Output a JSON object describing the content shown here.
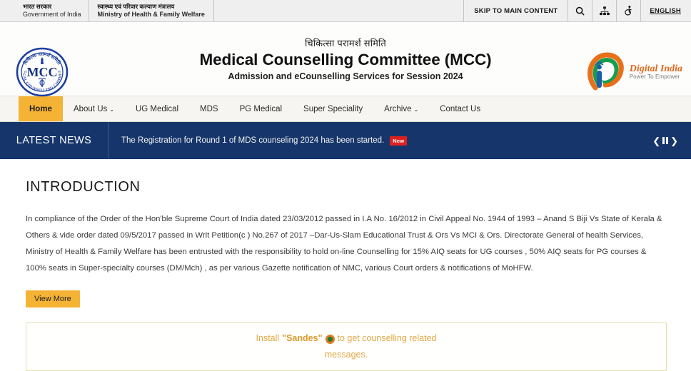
{
  "topbar": {
    "gov_hindi": "भारत सरकार",
    "gov_english": "Government of India",
    "ministry_hindi": "स्वास्थ्य एवं परिवार कल्याण मंत्रालय",
    "ministry_english": "Ministry of Health & Family Welfare",
    "skip_label": "SKIP TO MAIN CONTENT",
    "search_icon": "search-icon",
    "sitemap_icon": "sitemap-icon",
    "accessibility_icon": "accessibility-icon",
    "language_label": "ENGLISH"
  },
  "masthead": {
    "logo_text": "MCC",
    "logo_alt": "mcc-emblem",
    "title_hindi": "चिकित्सा परामर्श समिति",
    "title_main": "Medical Counselling Committee (MCC)",
    "title_sub": "Admission and eCounselling Services for Session 2024",
    "digital_india_name": "Digital India",
    "digital_india_tagline": "Power To Empower"
  },
  "nav": {
    "items": [
      {
        "label": "Home",
        "active": true,
        "caret": ""
      },
      {
        "label": "About Us",
        "active": false,
        "caret": "⌄"
      },
      {
        "label": "UG Medical",
        "active": false,
        "caret": ""
      },
      {
        "label": "MDS",
        "active": false,
        "caret": ""
      },
      {
        "label": "PG Medical",
        "active": false,
        "caret": ""
      },
      {
        "label": "Super Speciality",
        "active": false,
        "caret": ""
      },
      {
        "label": "Archive",
        "active": false,
        "caret": "⌄"
      },
      {
        "label": "Contact Us",
        "active": false,
        "caret": ""
      }
    ]
  },
  "news": {
    "label": "LATEST NEWS",
    "headline": "The Registration for Round 1 of MDS counseling 2024 has been started.",
    "badge": "New",
    "prev_icon": "chevron-left-icon",
    "pause_icon": "pause-icon",
    "next_icon": "chevron-right-icon"
  },
  "intro": {
    "heading": "INTRODUCTION",
    "paragraph": "In compliance of the Order of the Hon'ble Supreme Court of India dated 23/03/2012 passed in I.A No. 16/2012 in Civil Appeal No. 1944 of 1993 – Anand S Biji Vs State of Kerala & Others & vide order dated 09/5/2017 passed in Writ Petition(c ) No.267 of 2017 –Dar-Us-Slam Educational Trust & Ors Vs MCI & Ors. Directorate General of health Services, Ministry of Health & Family Welfare has been entrusted with the responsibility to hold on-line Counselling for 15% AIQ seats for UG courses , 50% AIQ seats for PG courses & 100% seats in Super-specialty courses (DM/Mch) , as per various Gazette notification of NMC, various Court orders & notifications of MoHFW.",
    "view_more_label": "View More"
  },
  "sandes": {
    "prefix": "Install",
    "app_name": "\"Sandes\"",
    "suffix": "to get counselling related",
    "second_line": "messages.",
    "app_icon": "sandes-app-icon"
  },
  "colors": {
    "accent_orange": "#f5b335",
    "news_navy": "#16366b",
    "badge_red": "#e02020",
    "sandes_gold": "#e0a845"
  }
}
